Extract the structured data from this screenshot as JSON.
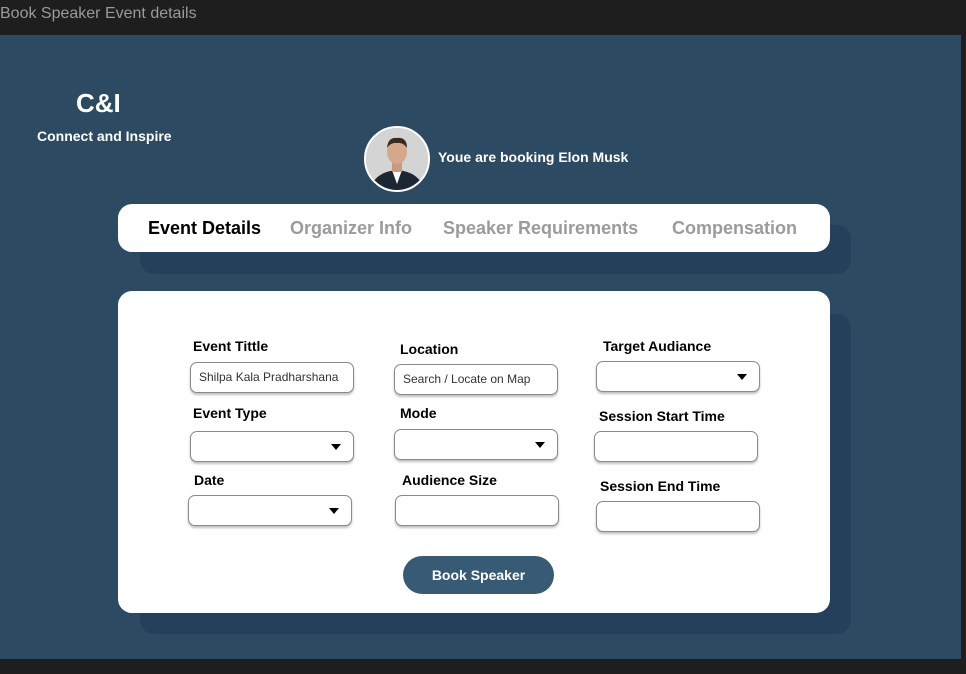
{
  "window": {
    "title": "Book Speaker Event details"
  },
  "brand": {
    "name": "C&I",
    "tagline": "Connect and Inspire"
  },
  "speaker": {
    "booking_text": "Youe are booking Elon Musk"
  },
  "tabs": [
    {
      "label": "Event Details",
      "active": true
    },
    {
      "label": "Organizer Info",
      "active": false
    },
    {
      "label": "Speaker Requirements",
      "active": false
    },
    {
      "label": "Compensation",
      "active": false
    }
  ],
  "form": {
    "event_title": {
      "label": "Event Tittle",
      "value": "Shilpa Kala Pradharshana"
    },
    "location": {
      "label": "Location",
      "placeholder": "Search / Locate on Map"
    },
    "target_audience": {
      "label": "Target Audiance",
      "value": ""
    },
    "event_type": {
      "label": "Event Type",
      "value": ""
    },
    "mode": {
      "label": "Mode",
      "value": ""
    },
    "session_start": {
      "label": "Session Start Time",
      "value": ""
    },
    "date": {
      "label": "Date",
      "value": ""
    },
    "audience_size": {
      "label": "Audience Size",
      "value": ""
    },
    "session_end": {
      "label": "Session End Time",
      "value": ""
    },
    "submit_label": "Book Speaker"
  },
  "colors": {
    "background": "#2c4a62",
    "button": "#375a75",
    "card": "#ffffff"
  }
}
